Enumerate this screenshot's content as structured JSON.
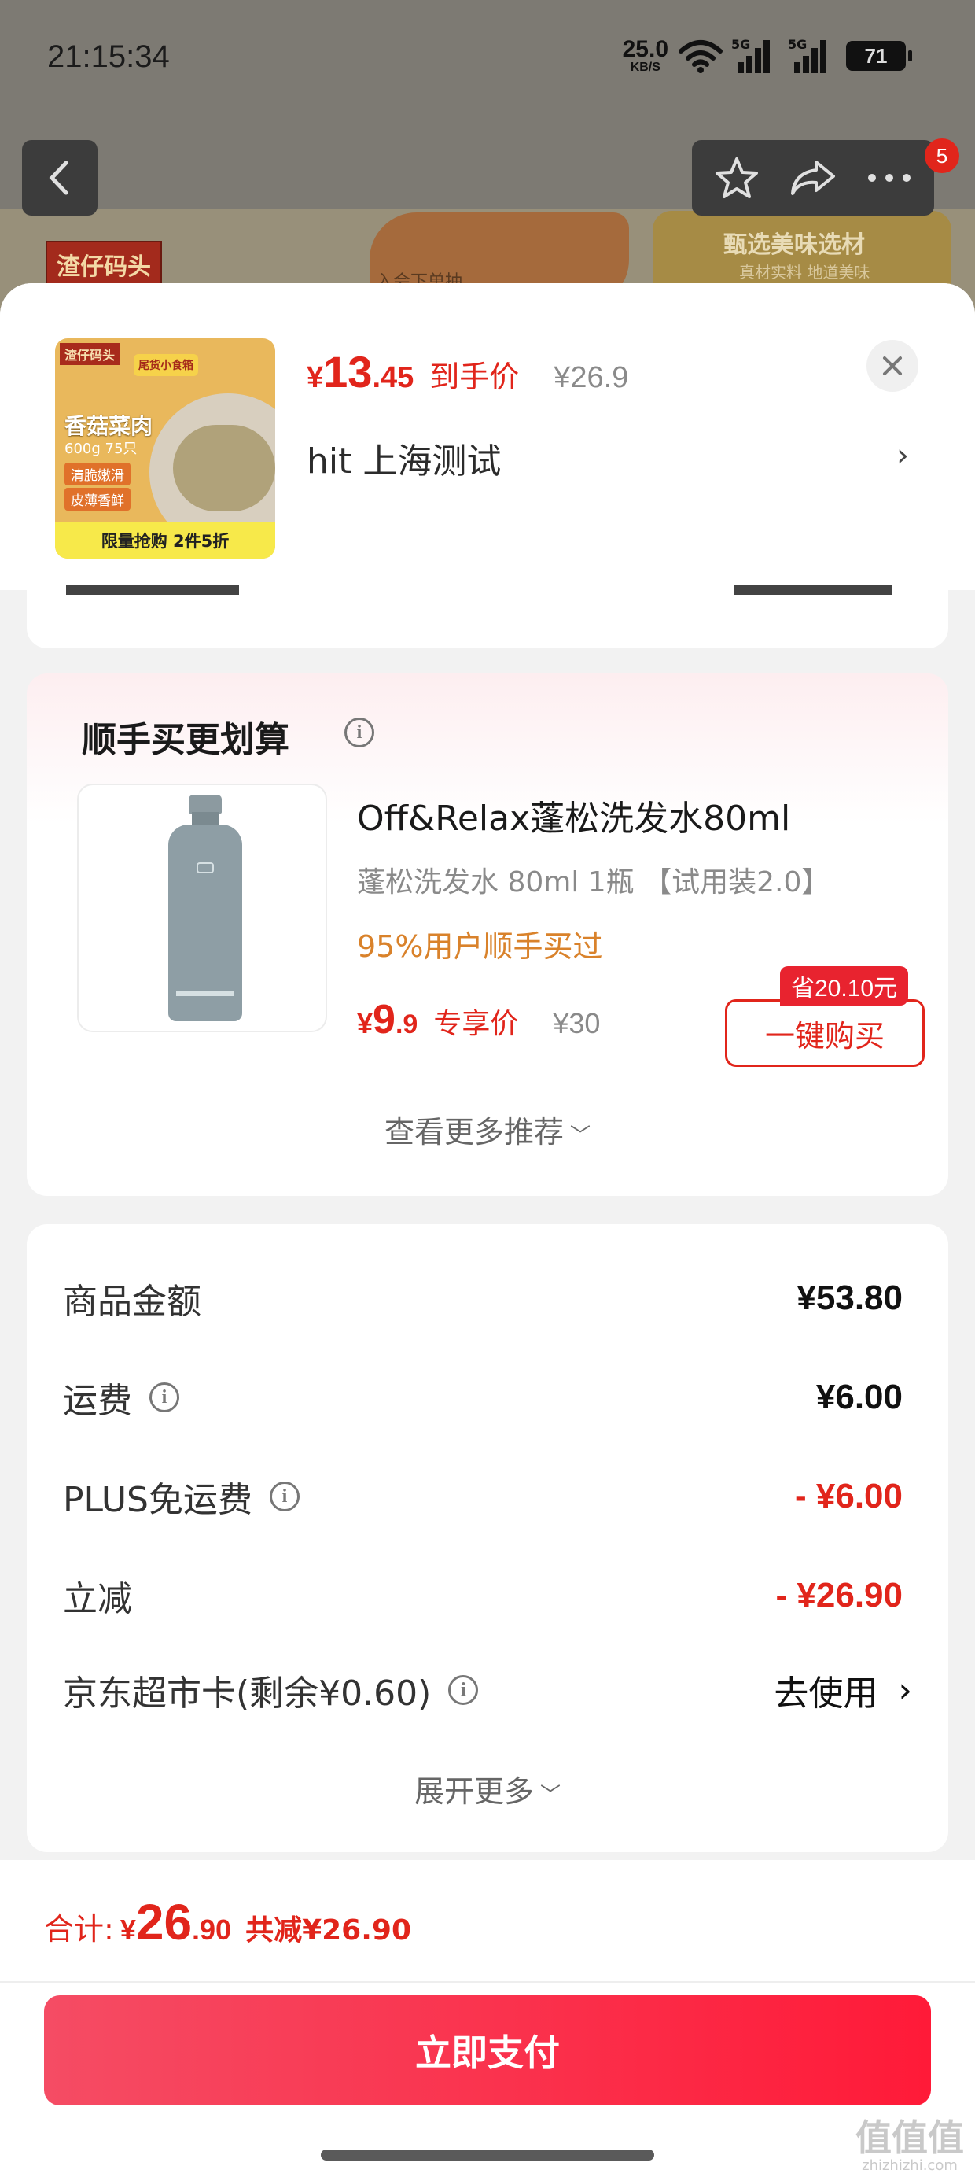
{
  "status_bar": {
    "time": "21:15:34",
    "speed_value": "25.0",
    "speed_unit": "KB/S",
    "signal_1": "5G",
    "signal_2": "5G",
    "battery": "71"
  },
  "background_page": {
    "brand": "渣仔码头",
    "banner_text": "入会下单抽",
    "right_title": "甄选美味选材",
    "right_subtitle": "真材实料 地道美味",
    "nav_badge": "5"
  },
  "product": {
    "thumb_brand": "渣仔码头",
    "thumb_title": "香菇菜肉",
    "thumb_spec": "600g 75只",
    "thumb_tag1": "清脆嫩滑",
    "thumb_tag2": "皮薄香鲜",
    "thumb_promo": "尾货小食箱",
    "thumb_bottom": "限量抢购 2件5折",
    "price_currency": "¥",
    "price_int": "13",
    "price_dec": ".45",
    "price_label": "到手价",
    "original_price": "¥26.9",
    "address": "hit  上海测试"
  },
  "recommend": {
    "title": "顺手买更划算",
    "item": {
      "name": "Off&Relax蓬松洗发水80ml",
      "spec": "蓬松洗发水 80ml 1瓶 【试用装2.0】",
      "stat": "95%用户顺手买过",
      "price_currency": "¥",
      "price_int": "9",
      "price_dec": ".9",
      "price_label": "专享价",
      "original_price": "¥30",
      "save_tag": "省20.10元",
      "buy_label": "一键购买"
    },
    "more_label": "查看更多推荐"
  },
  "summary": {
    "rows": [
      {
        "label": "商品金额",
        "value": "¥53.80",
        "info": false
      },
      {
        "label": "运费",
        "value": "¥6.00",
        "info": true
      },
      {
        "label": "PLUS免运费",
        "value": "- ¥6.00",
        "info": true
      },
      {
        "label": "立减",
        "value": "- ¥26.90",
        "info": false
      },
      {
        "label": "京东超市卡(剩余¥0.60)",
        "value": "去使用",
        "info": true
      }
    ],
    "expand_label": "展开更多"
  },
  "footer": {
    "total_label": "合计:",
    "total_currency": "¥",
    "total_int": "26",
    "total_dec": ".90",
    "total_reduced": "共减¥26.90",
    "pay_label": "立即支付"
  },
  "watermark": {
    "text": "值值值",
    "site": "zhizhizhi.com"
  },
  "colors": {
    "accent": "#e1251b",
    "pay_gradient_start": "#f54c64",
    "pay_gradient_end": "#ff1a38",
    "stat_orange": "#d9822b"
  }
}
